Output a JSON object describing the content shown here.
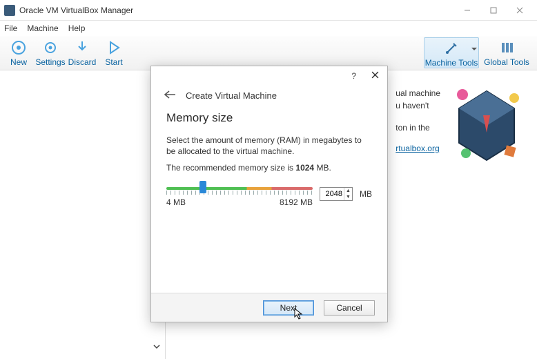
{
  "window": {
    "title": "Oracle VM VirtualBox Manager"
  },
  "menu": {
    "file": "File",
    "machine": "Machine",
    "help": "Help"
  },
  "toolbar": {
    "new": "New",
    "settings": "Settings",
    "discard": "Discard",
    "start": "Start",
    "machine_tools": "Machine Tools",
    "global_tools": "Global Tools"
  },
  "background": {
    "hint_l1": "ual machine",
    "hint_l2": "u haven't",
    "hint_l3": "ton in the",
    "link": "rtualbox.org"
  },
  "dialog": {
    "title": "Create Virtual Machine",
    "heading": "Memory size",
    "desc": "Select the amount of memory (RAM) in megabytes to be allocated to the virtual machine.",
    "rec_prefix": "The recommended memory size is ",
    "rec_value": "1024",
    "rec_suffix": " MB.",
    "min_label": "4 MB",
    "max_label": "8192 MB",
    "value": "2048",
    "unit": "MB",
    "slider_percent": 25,
    "next": "Next",
    "cancel": "Cancel"
  }
}
